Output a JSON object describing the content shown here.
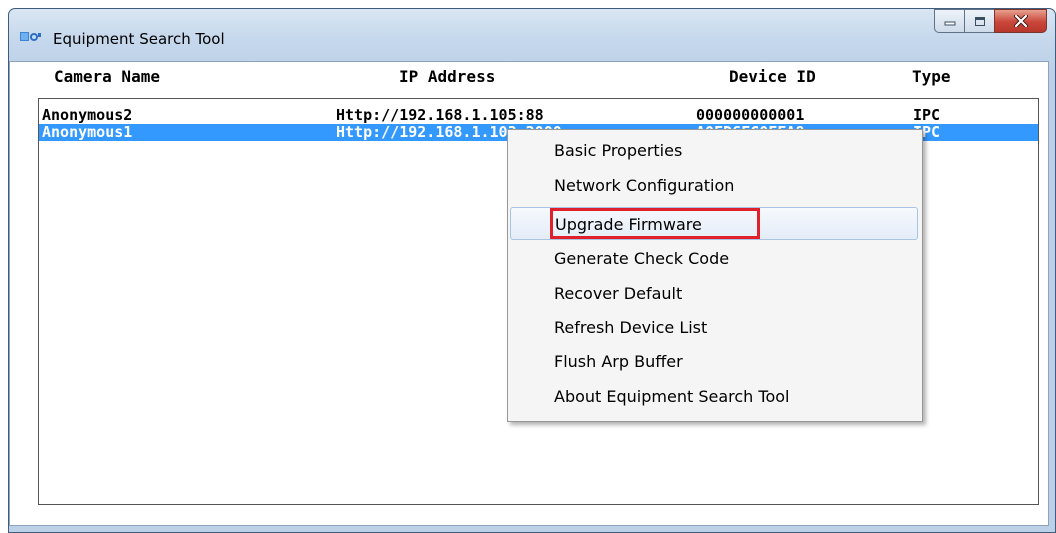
{
  "window": {
    "title": "Equipment Search Tool",
    "app_icon": "camera-search-icon",
    "controls": [
      "minimize-icon",
      "maximize-icon",
      "close-icon"
    ]
  },
  "list": {
    "columns": [
      "Camera Name",
      "IP Address",
      "Device ID",
      "Type"
    ],
    "rows": [
      {
        "name": "Anonymous2",
        "ip": "Http://192.168.1.105:88",
        "device_id": "000000000001",
        "type": "IPC",
        "selected": false
      },
      {
        "name": "Anonymous1",
        "ip": "Http://192.168.1.103:2000",
        "device_id": "A0FD6FC0FFA8",
        "type": "IPC",
        "selected": true
      }
    ]
  },
  "context_menu": {
    "items": [
      {
        "label": "Basic Properties"
      },
      {
        "label": "Network Configuration"
      },
      {
        "label": "Upgrade Firmware",
        "hovered": true,
        "highlighted": true
      },
      {
        "label": "Generate Check Code"
      },
      {
        "label": "Recover Default"
      },
      {
        "label": "Refresh Device List"
      },
      {
        "label": "Flush Arp Buffer"
      },
      {
        "label": "About Equipment Search Tool"
      }
    ]
  },
  "colors": {
    "selection": "#3399ff",
    "highlight_border": "#e0202a",
    "close_button": "#c9463a"
  }
}
